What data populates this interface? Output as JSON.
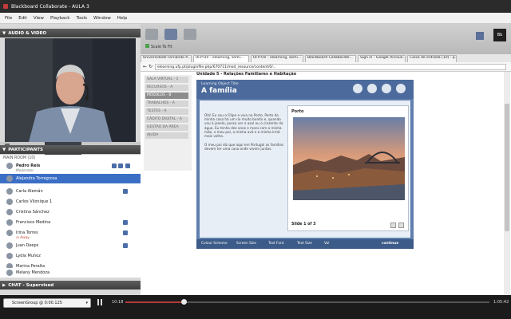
{
  "window": {
    "title": "Blackboard Collaborate - AULA 3"
  },
  "menu": [
    "File",
    "Edit",
    "View",
    "Playback",
    "Tools",
    "Window",
    "Help"
  ],
  "audio_video": {
    "header": "AUDIO & VIDEO"
  },
  "participants": {
    "header": "PARTICIPANTS",
    "room": "MAIN ROOM (10)",
    "people": [
      {
        "name": "Pedro Reis",
        "role": "Moderator"
      },
      {
        "name": "Alejandra Torregrosa"
      },
      {
        "name": "Carla Alemán"
      },
      {
        "name": "Carlos Vilonique 1"
      },
      {
        "name": "Cristina Sánchez"
      },
      {
        "name": "Francisco Medina"
      },
      {
        "name": "Irina Torres",
        "status": "Away"
      },
      {
        "name": "Juan Deeps"
      },
      {
        "name": "Lydia Muñoz"
      },
      {
        "name": "Marina Peralta"
      },
      {
        "name": "Melany Mendoza"
      }
    ]
  },
  "chat": {
    "header": "CHAT - Supervised"
  },
  "toolstrip": {
    "scale_label": "Scale To Fit"
  },
  "browser": {
    "tabs": [
      "Universidade Fernando P...",
      "UFP-UV - elearning, semi...",
      "UFP-UV - elearning, semi...",
      "Blackboard Collaborate...",
      "Sign in - Google Accoun...",
      "Caixa de entrada (10) - p..."
    ],
    "url": "elearning.ufp.pt/pluginfile.php/670711/mod_resource/content/0/..."
  },
  "sidenav": [
    "SALA VIRTUAL - 1",
    "RECURSOS - A",
    "MÓDULOS - B",
    "TRABALHOS - A",
    "TESTES - A",
    "CÁDITO DIGITAL - A",
    "GESTÃO DA ÁREA",
    "AJUDA"
  ],
  "sidenav_active": 2,
  "page": {
    "header": "Unidade 5 - Relações Familiares e Habitação",
    "lesson_caption": "Learning Object Title",
    "lesson_title": "A família",
    "paragraph1": "Olá! Eu sou o Filipe e vivo no Porto. Perto da minha casa há um rio muito bonito e, quando vou à janela, posso ver o azul ou o cinzento da água. Eu tenho dez anos e moro com a minha mãe, o meu pai, a minha avó e a minha irmã mais velha.",
    "paragraph2": "O meu pai diz que aqui em Portugal as famílias devem ter uma casa onde vivem juntas.",
    "card_title": "Porto",
    "slide_label": "Slide 1 of 3",
    "controls": [
      "Colour Scheme",
      "Screen Size",
      "Text Font",
      "Text Size",
      "Vol",
      "continue"
    ]
  },
  "playback": {
    "session": "ScreenGroup @ 0:00.125",
    "current_time": "10:18",
    "total_time": "1:05:42",
    "progress": 0.16
  }
}
